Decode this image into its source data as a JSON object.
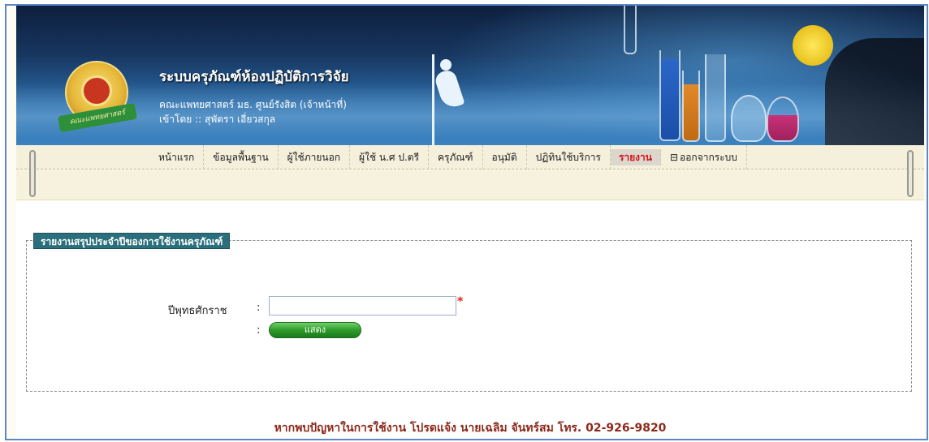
{
  "header": {
    "title": "ระบบครุภัณฑ์ห้องปฏิบัติการวิจัย",
    "subtitle": "คณะแพทยศาสตร์ มธ. ศูนย์รังสิต (เจ้าหน้าที่)",
    "login_line": "เข้าโดย :: สุพัตรา เอี่ยวสกุล",
    "logo_ribbon_text": "คณะแพทยศาสตร์"
  },
  "nav": {
    "items": [
      {
        "label": "หน้าแรก"
      },
      {
        "label": "ข้อมูลพื้นฐาน"
      },
      {
        "label": "ผู้ใช้ภายนอก"
      },
      {
        "label": "ผู้ใช้ น.ศ ป.ตรี"
      },
      {
        "label": "ครุภัณฑ์"
      },
      {
        "label": "อนุมัติ"
      },
      {
        "label": "ปฏิทินใช้บริการ"
      },
      {
        "label": "รายงาน"
      },
      {
        "label": "ออกจากระบบ"
      }
    ],
    "active": "รายงาน",
    "exit_icon": "logout-icon"
  },
  "form": {
    "legend": "รายงานสรุปประจำปีของการใช้งานครุภัณฑ์",
    "year_label": "ปีพุทธศักราช",
    "colon": ":",
    "year_value": "",
    "required_mark": "*",
    "submit_label": "แสดง"
  },
  "footer": {
    "text": "หากพบปัญหาในการใช้งาน โปรดแจ้ง นายเฉลิม จันทร์สม โทร. 02-926-9820"
  },
  "colors": {
    "accent": "#2a6f7b",
    "active_nav": "#d1141d",
    "button_green": "#2e9b2a",
    "footer_text": "#8b2a1a",
    "frame_border": "#5b87c5"
  }
}
